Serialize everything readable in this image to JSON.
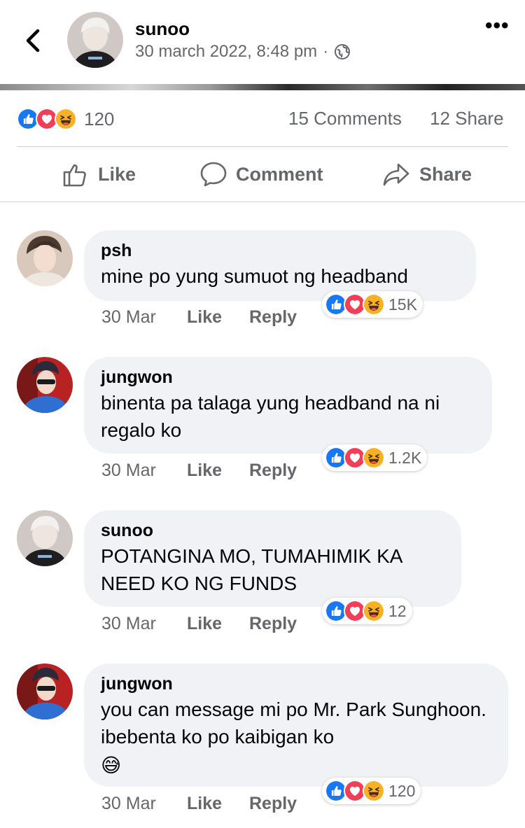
{
  "post": {
    "author": "sunoo",
    "timestamp": "30 march 2022, 8:48 pm",
    "separator": "·",
    "privacy_icon": "globe-icon",
    "more_label": "•••"
  },
  "stats": {
    "reactions_count": "120",
    "comments": "15 Comments",
    "shares": "12 Share"
  },
  "actions": {
    "like": "Like",
    "comment": "Comment",
    "share": "Share"
  },
  "colors": {
    "like_blue": "#1877f2",
    "love_red": "#f33e58",
    "haha_yellow": "#f7b125",
    "meta_gray": "#65676b",
    "bubble_bg": "#f0f2f5"
  },
  "comments": [
    {
      "name": "psh",
      "text": "mine po yung sumuot ng headband",
      "reactions": "15K",
      "time": "30 Mar",
      "like": "Like",
      "reply": "Reply"
    },
    {
      "name": "jungwon",
      "text": "binenta pa talaga yung headband na ni regalo ko",
      "reactions": "1.2K",
      "time": "30 Mar",
      "like": "Like",
      "reply": "Reply"
    },
    {
      "name": "sunoo",
      "text": "POTANGINA MO, TUMAHIMIK KA NEED KO NG FUNDS",
      "reactions": "12",
      "time": "30 Mar",
      "like": "Like",
      "reply": "Reply"
    },
    {
      "name": "jungwon",
      "text": "you can message mi po Mr. Park Sunghoon. ibebenta ko po kaibigan ko",
      "emoji": "😅",
      "reactions": "120",
      "time": "30 Mar",
      "like": "Like",
      "reply": "Reply"
    }
  ]
}
